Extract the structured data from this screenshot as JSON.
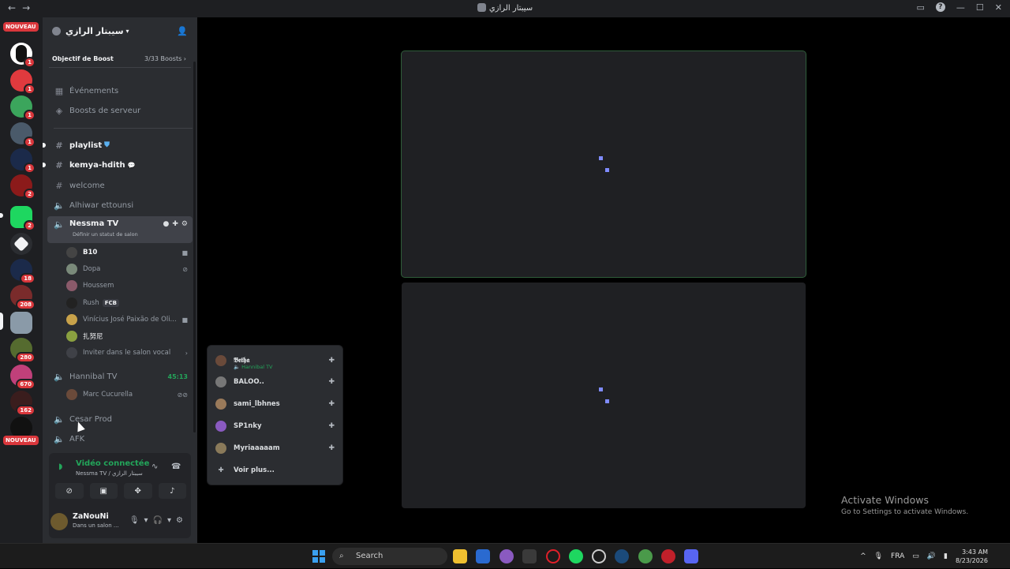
{
  "window": {
    "title": "سيبتار الرازي",
    "nav_back": "←",
    "nav_forward": "→",
    "controls": [
      "—",
      "☐",
      "✕"
    ],
    "help": "?"
  },
  "guilds": {
    "nouveau_top": "NOUVEAU",
    "nouveau_bottom": "NOUVEAU",
    "badges": [
      "1",
      "1",
      "1",
      "1",
      "1",
      "2",
      "2",
      "18",
      "208",
      "280",
      "670",
      "162"
    ]
  },
  "sidebar": {
    "server_name": "سيبتار الرازي",
    "boost_label": "Objectif de Boost",
    "boost_count": "3/33 Boosts",
    "events": "Événements",
    "boosts": "Boosts de serveur",
    "channels": {
      "playlist": "playlist",
      "kemya": "kemya-hdith",
      "welcome": "welcome",
      "alhiwar": "Alhiwar ettounsi",
      "nessma": "Nessma TV",
      "nessma_sub": "Définir un statut de salon",
      "hannibal": "Hannibal TV",
      "hannibal_timer": "45:13",
      "cesar": "Cesar Prod",
      "afk": "AFK"
    },
    "nessma_users": [
      "B10",
      "Dopa",
      "Houssem",
      "Rush",
      "Vinícius José Paixão de Oli...",
      "扎努尼"
    ],
    "rush_tag": "FCB",
    "invite": "Inviter dans le salon vocal",
    "hannibal_users": [
      "Marc Cucurella"
    ]
  },
  "voice": {
    "status": "Vidéo connectée",
    "channel": "Nessma TV / سيبتار الرازي"
  },
  "me": {
    "name": "ZaNouNi",
    "status": "Dans un salon ..."
  },
  "popup": {
    "users": [
      {
        "name": "𝕭𝖊𝖙𝖍𝖆",
        "sub": "Hannibal TV"
      },
      {
        "name": "BALOO.."
      },
      {
        "name": "sami_lbhnes"
      },
      {
        "name": "SP1nky"
      },
      {
        "name": "Myriaaaaam"
      }
    ],
    "more": "Voir plus..."
  },
  "watermark": {
    "line1": "Activate Windows",
    "line2": "Go to Settings to activate Windows."
  },
  "taskbar": {
    "search": "Search",
    "lang": "FRA",
    "time": "3:43 AM",
    "date": "8/23/2026"
  },
  "colors": {
    "accent_green": "#23a55a",
    "badge_red": "#da373c",
    "spinner": "#7f8bff"
  }
}
